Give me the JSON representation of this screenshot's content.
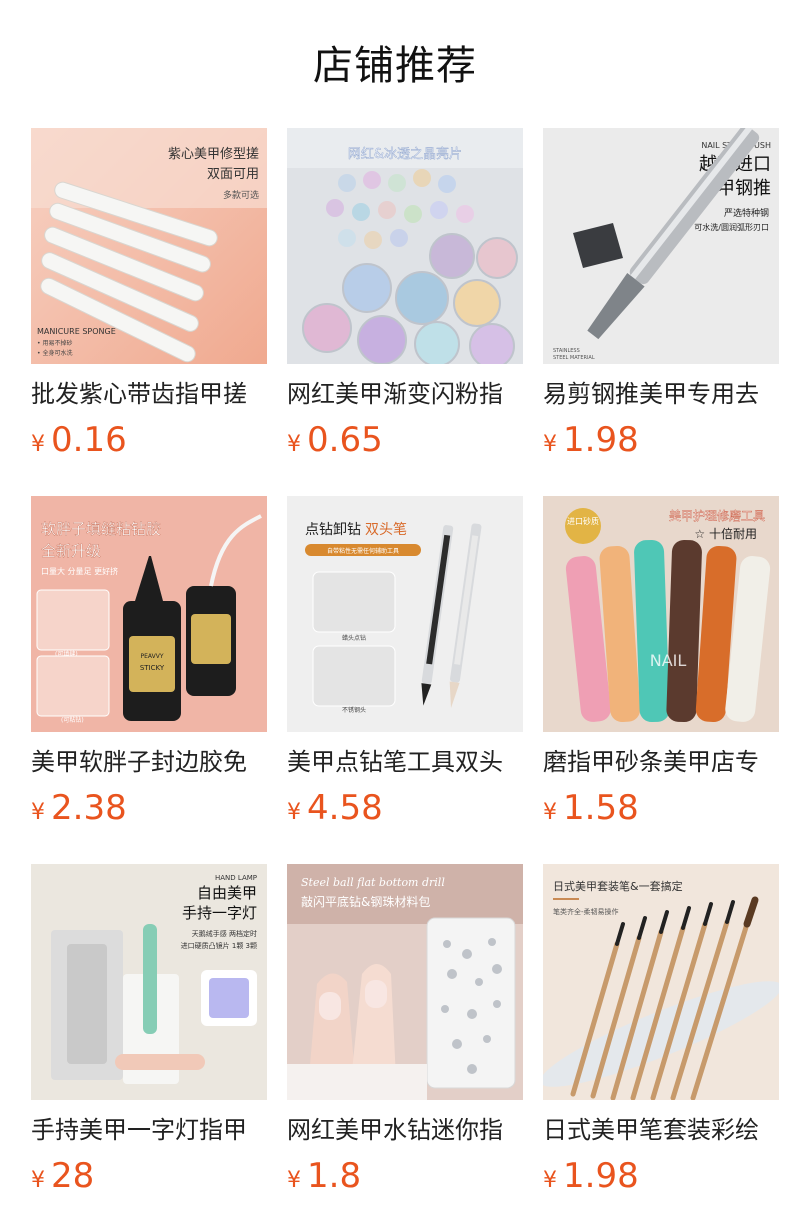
{
  "header": {
    "title": "店铺推荐"
  },
  "currency_symbol": "¥",
  "products": [
    {
      "name": "批发紫心带齿指甲搓",
      "price": "0.16",
      "image_text": [
        "紫心美甲修型搓",
        "双面可用",
        "多款可选",
        "MANICURE SPONGE",
        "• 用易不掉砂",
        "• 全身可水洗"
      ],
      "accent": "#f2c2b0"
    },
    {
      "name": "网红美甲渐变闪粉指",
      "price": "0.65",
      "image_text": [
        "网红&冰透之晶亮片"
      ],
      "accent": "#d9dde3"
    },
    {
      "name": "易剪钢推美甲专用去",
      "price": "1.98",
      "image_text": [
        "NAIL STEEL PUSH",
        "越南进口",
        "美甲钢推",
        "严选特种钢",
        "可水洗/圆润弧形刃口",
        "STAINLESS",
        "STEEL MATERIAL"
      ],
      "accent": "#e8e8e8"
    },
    {
      "name": "美甲软胖子封边胶免",
      "price": "2.38",
      "image_text": [
        "软胖子填缝粘钻胶",
        "全新升级",
        "口量大 分量足 更好挤",
        "PEAVVY",
        "STICKY",
        "(可填缝)",
        "(可粘钻)"
      ],
      "accent": "#f0b3a3"
    },
    {
      "name": "美甲点钻笔工具双头",
      "price": "4.58",
      "image_text": [
        "点钻卸钻",
        "双头笔",
        "自带粘性无需任何辅助工具",
        "蜡头点钻",
        "不锈钢头"
      ],
      "accent": "#ececec"
    },
    {
      "name": "磨指甲砂条美甲店专",
      "price": "1.58",
      "image_text": [
        "进口砂质",
        "美甲护理修磨工具",
        "☆ 十倍耐用",
        "NAIL"
      ],
      "accent": "#e7d3c4"
    },
    {
      "name": "手持美甲一字灯指甲",
      "price": "28",
      "image_text": [
        "HAND LAMP",
        "自由美甲",
        "手持一字灯",
        "天鹅绒手感 两档定时",
        "进口硬质凸镜片 1颗 3颗"
      ],
      "accent": "#e9e5dd"
    },
    {
      "name": "网红美甲水钻迷你指",
      "price": "1.8",
      "image_text": [
        "Steel ball flat bottom drill",
        "敲闪平底钻&钢珠材料包"
      ],
      "accent": "#e7c7bf"
    },
    {
      "name": "日式美甲笔套装彩绘",
      "price": "1.98",
      "image_text": [
        "日式美甲套装笔&一套搞定",
        "笔类齐全-柔韧易操作"
      ],
      "accent": "#efe2d6"
    }
  ]
}
